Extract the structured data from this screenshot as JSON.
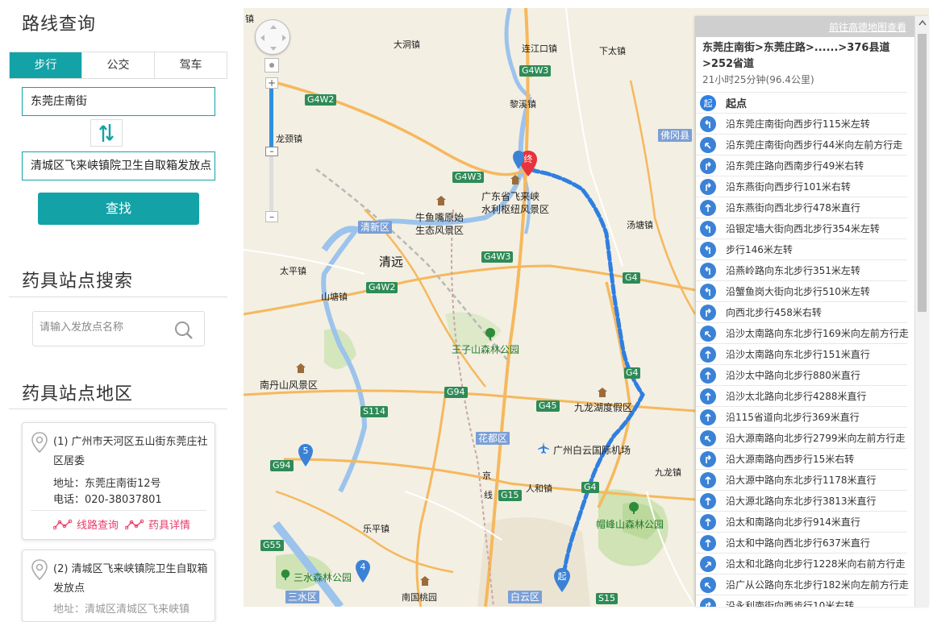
{
  "route_query": {
    "title": "路线查询",
    "tabs": [
      "步行",
      "公交",
      "驾车"
    ],
    "active_tab": 0,
    "origin": "东莞庄南街",
    "destination": "清城区飞来峡镇院卫生自取箱发放点",
    "search_label": "查找"
  },
  "station_search": {
    "title": "药具站点搜索",
    "placeholder": "请输入发放点名称"
  },
  "station_region": {
    "title": "药具站点地区",
    "items": [
      {
        "name": "(1) 广州市天河区五山街东莞庄社区居委",
        "address": "地址：东莞庄南街12号",
        "phone": "电话：020-38037801",
        "route_link": "线路查询",
        "detail_link": "药具详情"
      },
      {
        "name": "(2) 清城区飞来峡镇院卫生自取箱发放点",
        "address": "地址：清城区清城区飞来峡镇"
      }
    ]
  },
  "map": {
    "labels": {
      "dadongzhen": "大洞镇",
      "liankoukou": "连江口镇",
      "xiatanzhen": "下太镇",
      "jing": "京",
      "lixizhen": "黎溪镇",
      "longjingzhen": "龙颈镇",
      "foshanxian": "佛冈县",
      "feilaixia": "广东省飞来峡\n水利枢纽风景区",
      "niuyuzui": "牛鱼嘴原始\n生态风景区",
      "tangtangzhen": "汤塘镇",
      "qingxinqu": "清新区",
      "qingyuan": "清远",
      "taipingzhen": "太平镇",
      "shanhuzhen": "山塘镇",
      "wangzishan": "王子山森林公园",
      "nandanshan": "南丹山风景区",
      "jiulonghu": "九龙湖度假区",
      "huaduqu": "花都区",
      "airport": "广州白云国际机场",
      "jing2": "京",
      "xian": "线",
      "renhezhen": "人和镇",
      "jiufozhen": "九龙镇",
      "maofeng": "帽峰山森林公园",
      "lepingzhen": "乐平镇",
      "sanshui": "三水森林公园",
      "nanguotaoyuan": "南国桃园",
      "sanshuiqu": "三水区",
      "baiyunqu": "白云区",
      "zhen_top": "镇"
    },
    "roads": {
      "g4w3_top": "G4W3",
      "g4w2_a": "G4W2",
      "g4w3_mid": "G4W3",
      "g4w3_lower": "G4W3",
      "g4w2_b": "G4W2",
      "g4_a": "G4",
      "g94": "G94",
      "s114": "S114",
      "g45": "G45",
      "g4_b": "G4",
      "g15": "G15",
      "g94_b": "G94",
      "g55": "G55",
      "s15": "S15",
      "g4_c": "G4"
    },
    "markers": {
      "end": "终",
      "start": "起",
      "m5": "5",
      "m4": "4"
    }
  },
  "route_panel": {
    "link": "前往高德地图查看",
    "title": "东莞庄南街>东莞庄路>......>376县道>252省道",
    "summary": "21小时25分钟(96.4公里)",
    "steps": [
      {
        "icon": "start",
        "text": "起点"
      },
      {
        "icon": "left",
        "text": "沿东莞庄南街向西步行115米左转"
      },
      {
        "icon": "left-front",
        "text": "沿东莞庄南街向西步行44米向左前方行走"
      },
      {
        "icon": "right",
        "text": "沿东莞庄路向西南步行49米右转"
      },
      {
        "icon": "right",
        "text": "沿东燕街向西步行101米右转"
      },
      {
        "icon": "straight",
        "text": "沿东燕街向西北步行478米直行"
      },
      {
        "icon": "left",
        "text": "沿银定墙大街向西北步行354米左转"
      },
      {
        "icon": "left",
        "text": "步行146米左转"
      },
      {
        "icon": "left",
        "text": "沿燕岭路向东北步行351米左转"
      },
      {
        "icon": "left",
        "text": "沿蟹鱼岗大街向北步行510米左转"
      },
      {
        "icon": "right",
        "text": "向西北步行458米右转"
      },
      {
        "icon": "left-front",
        "text": "沿沙太南路向东北步行169米向左前方行走"
      },
      {
        "icon": "straight",
        "text": "沿沙太南路向东北步行151米直行"
      },
      {
        "icon": "straight",
        "text": "沿沙太中路向北步行880米直行"
      },
      {
        "icon": "straight",
        "text": "沿沙太北路向北步行4288米直行"
      },
      {
        "icon": "straight",
        "text": "沿115省道向北步行369米直行"
      },
      {
        "icon": "left-front",
        "text": "沿大源南路向北步行2799米向左前方行走"
      },
      {
        "icon": "right",
        "text": "沿大源南路向西步行15米右转"
      },
      {
        "icon": "straight",
        "text": "沿大源中路向东北步行1178米直行"
      },
      {
        "icon": "straight",
        "text": "沿大源北路向东北步行3813米直行"
      },
      {
        "icon": "straight",
        "text": "沿太和南路向北步行914米直行"
      },
      {
        "icon": "straight",
        "text": "沿太和中路向西北步行637米直行"
      },
      {
        "icon": "right-front",
        "text": "沿太和北路向北步行1228米向右前方行走"
      },
      {
        "icon": "left-front",
        "text": "沿广从公路向东北步行182米向左前方行走"
      },
      {
        "icon": "right",
        "text": "沿永利南街向西步行10米右转"
      }
    ]
  }
}
